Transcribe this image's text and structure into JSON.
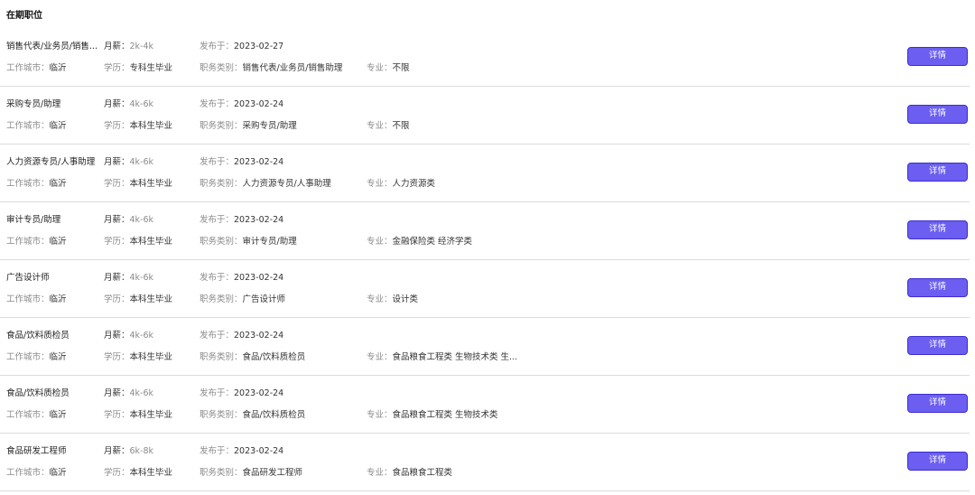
{
  "section_title": "在期职位",
  "labels": {
    "salary": "月薪：",
    "published": "发布于：",
    "city": "工作城市：",
    "education": "学历：",
    "category": "职务类别：",
    "major": "专业："
  },
  "detail_button_label": "详情",
  "jobs": [
    {
      "title": "销售代表/业务员/销售...",
      "salary": "2k-4k",
      "date": "2023-02-27",
      "city": "临沂",
      "education": "专科生毕业",
      "category": "销售代表/业务员/销售助理",
      "major": "不限"
    },
    {
      "title": "采购专员/助理",
      "salary": "4k-6k",
      "date": "2023-02-24",
      "city": "临沂",
      "education": "本科生毕业",
      "category": "采购专员/助理",
      "major": "不限"
    },
    {
      "title": "人力资源专员/人事助理",
      "salary": "4k-6k",
      "date": "2023-02-24",
      "city": "临沂",
      "education": "本科生毕业",
      "category": "人力资源专员/人事助理",
      "major": "人力资源类"
    },
    {
      "title": "审计专员/助理",
      "salary": "4k-6k",
      "date": "2023-02-24",
      "city": "临沂",
      "education": "本科生毕业",
      "category": "审计专员/助理",
      "major": "金融保险类  经济学类"
    },
    {
      "title": "广告设计师",
      "salary": "4k-6k",
      "date": "2023-02-24",
      "city": "临沂",
      "education": "本科生毕业",
      "category": "广告设计师",
      "major": "设计类"
    },
    {
      "title": "食品/饮料质检员",
      "salary": "4k-6k",
      "date": "2023-02-24",
      "city": "临沂",
      "education": "本科生毕业",
      "category": "食品/饮料质检员",
      "major": "食品粮食工程类  生物技术类  生..."
    },
    {
      "title": "食品/饮料质检员",
      "salary": "4k-6k",
      "date": "2023-02-24",
      "city": "临沂",
      "education": "本科生毕业",
      "category": "食品/饮料质检员",
      "major": "食品粮食工程类  生物技术类"
    },
    {
      "title": "食品研发工程师",
      "salary": "6k-8k",
      "date": "2023-02-24",
      "city": "临沂",
      "education": "本科生毕业",
      "category": "食品研发工程师",
      "major": "食品粮食工程类"
    }
  ],
  "colors": {
    "button_bg": "#6b5ef0",
    "button_border": "#3c2fd0",
    "divider": "#dcdcdc",
    "label_gray": "#8a8a8a"
  }
}
